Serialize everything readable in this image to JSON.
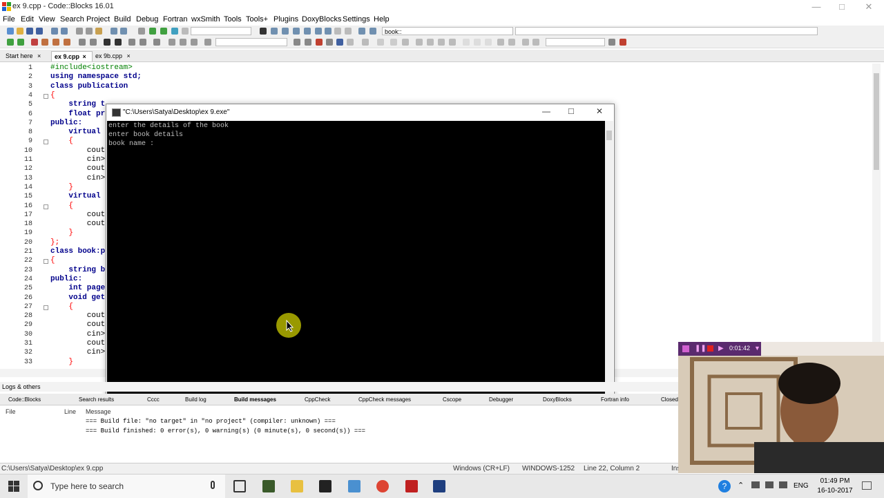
{
  "window": {
    "title": "ex 9.cpp - Code::Blocks 16.01"
  },
  "menu": [
    "File",
    "Edit",
    "View",
    "Search",
    "Project",
    "Build",
    "Debug",
    "Fortran",
    "wxSmith",
    "Tools",
    "Tools+",
    "Plugins",
    "DoxyBlocks",
    "Settings",
    "Help"
  ],
  "toolbar": {
    "symbol_combo": "book::"
  },
  "editor_tabs": [
    "Start here",
    "ex 9.cpp",
    "ex 9b.cpp"
  ],
  "editor": {
    "line_numbers": [
      "1",
      "2",
      "3",
      "4",
      "5",
      "6",
      "7",
      "8",
      "9",
      "10",
      "11",
      "12",
      "13",
      "14",
      "15",
      "16",
      "17",
      "18",
      "19",
      "20",
      "21",
      "22",
      "23",
      "24",
      "25",
      "26",
      "27",
      "28",
      "29",
      "30",
      "31",
      "32",
      "33"
    ],
    "lines": [
      "#include<iostream>",
      "using namespace std;",
      "class publication",
      "{",
      "    string t",
      "    float pr",
      "public:",
      "    virtual ",
      "    {",
      "        cout",
      "        cin>",
      "        cout",
      "        cin>",
      "    }",
      "    virtual ",
      "    {",
      "        cout",
      "        cout",
      "    }",
      "};",
      "class book:p",
      "{",
      "    string b",
      "public:",
      "    int page",
      "    void get",
      "    {",
      "        cout",
      "        cout",
      "        cin>",
      "        cout",
      "        cin>",
      "    }"
    ]
  },
  "console": {
    "title": "\"C:\\Users\\Satya\\Desktop\\ex 9.exe\"",
    "lines": [
      "enter the details of the book",
      "enter book details",
      "book name :"
    ]
  },
  "logs": {
    "header": "Logs & others",
    "tabs": [
      "Code::Blocks",
      "Search results",
      "Cccc",
      "Build log",
      "Build messages",
      "CppCheck",
      "CppCheck messages",
      "Cscope",
      "Debugger",
      "DoxyBlocks",
      "Fortran info",
      "Closed"
    ],
    "columns": [
      "File",
      "Line",
      "Message"
    ],
    "messages": [
      "=== Build file: \"no target\" in \"no project\" (compiler: unknown) ===",
      "=== Build finished: 0 error(s), 0 warning(s) (0 minute(s), 0 second(s)) ==="
    ]
  },
  "statusbar": {
    "path": "C:\\Users\\Satya\\Desktop\\ex 9.cpp",
    "eol": "Windows (CR+LF)",
    "encoding": "WINDOWS-1252",
    "position": "Line 22, Column 2",
    "mode": "Ins"
  },
  "webcam": {
    "timer": "0:01:42"
  },
  "taskbar": {
    "search_placeholder": "Type here to search",
    "lang": "ENG",
    "time": "01:49 PM",
    "date": "16-10-2017"
  }
}
